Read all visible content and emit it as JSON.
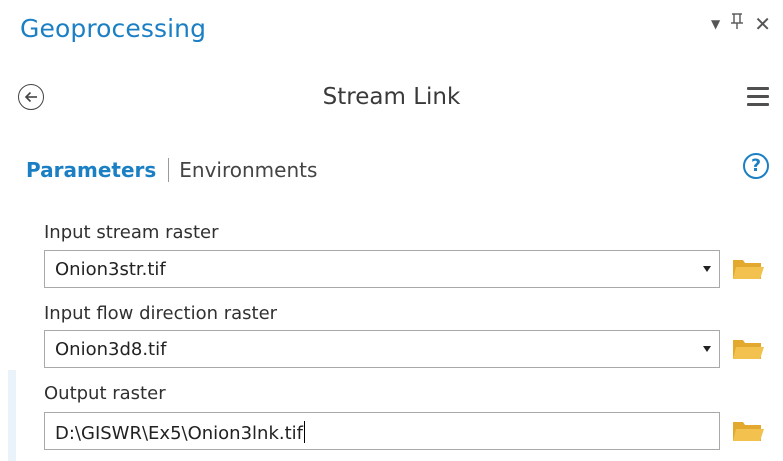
{
  "panel": {
    "title": "Geoprocessing",
    "controls": {
      "dropdown_icon": "dropdown-arrow-icon",
      "pin_icon": "pin-icon",
      "close_icon": "close-icon",
      "dropdown_glyph": "▼",
      "pin_glyph": "ᛩ",
      "close_glyph": "✕"
    }
  },
  "tool": {
    "title": "Stream Link",
    "back_icon": "back-arrow-icon",
    "menu_icon": "hamburger-menu-icon"
  },
  "tabs": {
    "parameters": "Parameters",
    "environments": "Environments",
    "help_glyph": "?"
  },
  "params": [
    {
      "label": "Input stream raster",
      "value": "Onion3str.tif",
      "has_dropdown": true
    },
    {
      "label": "Input flow direction raster",
      "value": "Onion3d8.tif",
      "has_dropdown": true
    },
    {
      "label": "Output raster",
      "value": "D:\\GISWR\\Ex5\\Onion3lnk.tif",
      "has_dropdown": false
    }
  ],
  "colors": {
    "accent": "#1b7fc4",
    "folder": "#f2c14e",
    "field_border": "#a9a9a9"
  }
}
